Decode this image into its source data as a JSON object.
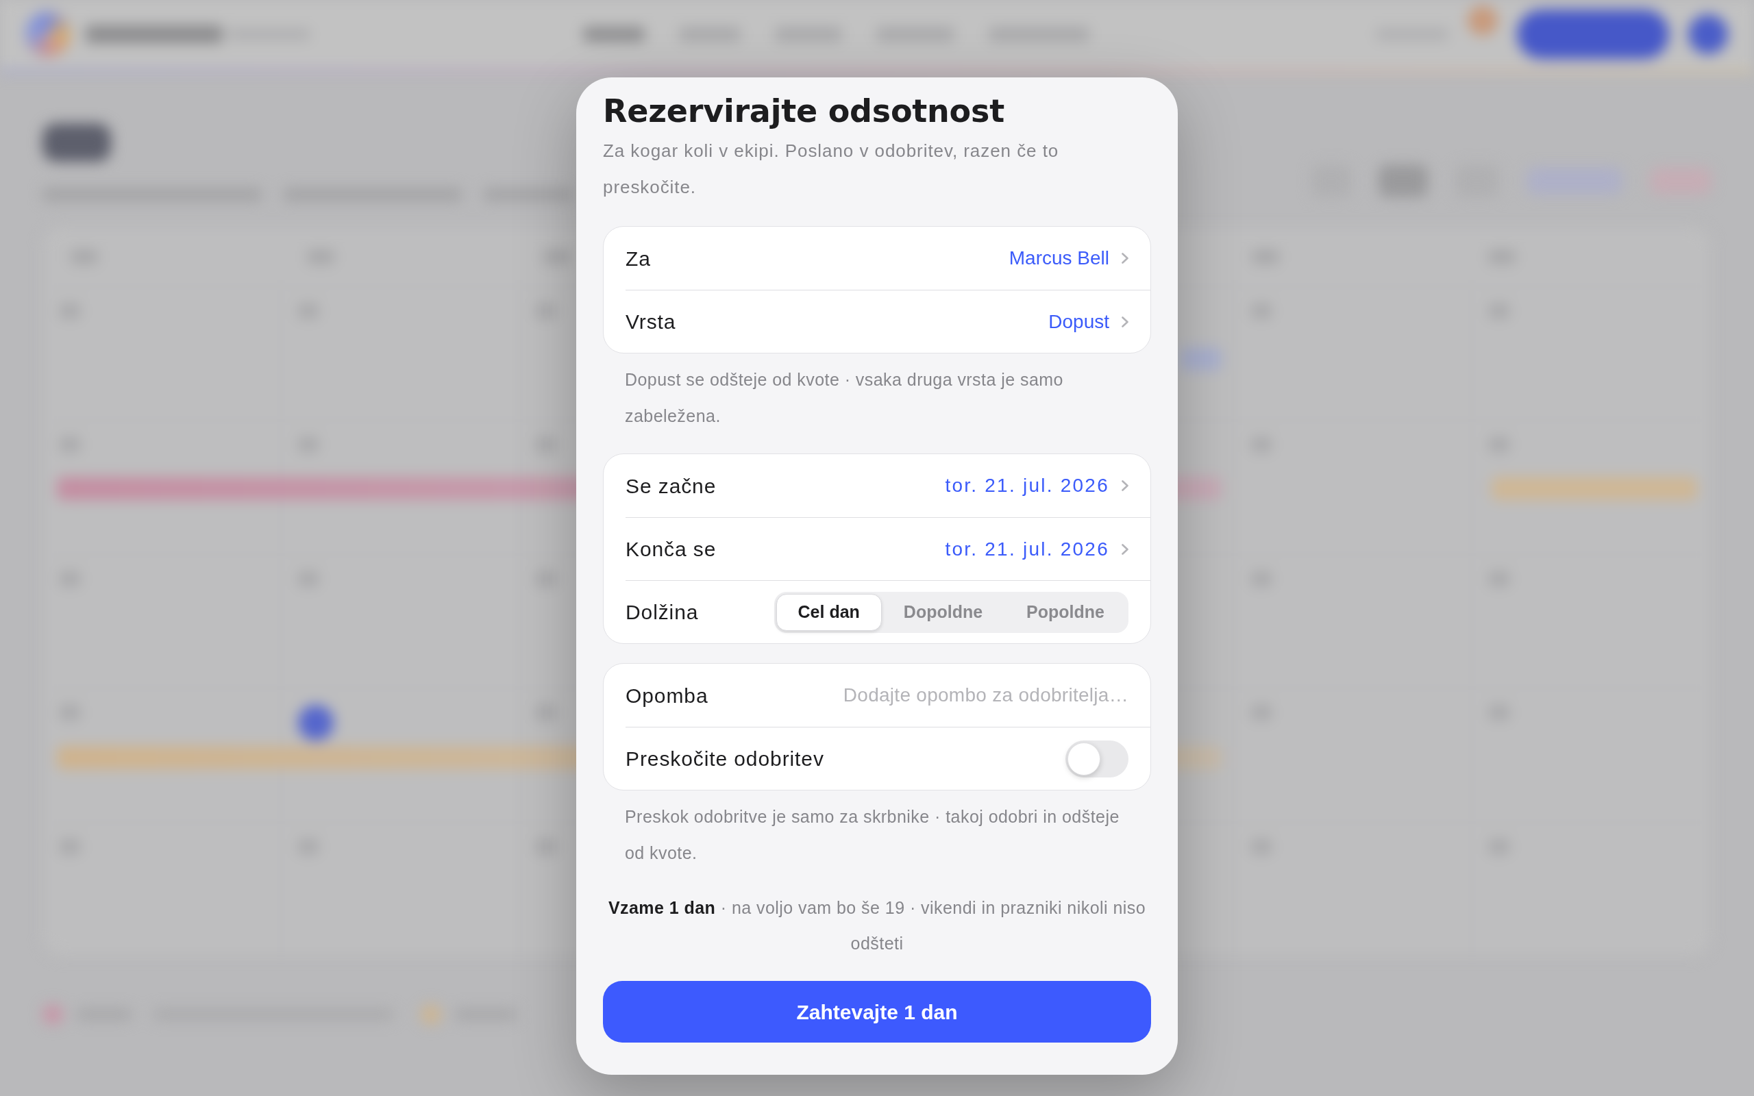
{
  "dialog": {
    "title": "Rezervirajte odsotnost",
    "subtitle": "Za kogar koli v ekipi. Poslano v odobritev, razen če to preskočite.",
    "sections": [
      {
        "rows": [
          {
            "kind": "picker",
            "label": "Za",
            "value": "Marcus Bell"
          },
          {
            "kind": "picker",
            "label": "Vrsta",
            "value": "Dopust"
          }
        ],
        "footnote": "Dopust se odšteje od kvote · vsaka druga vrsta je samo zabeležena."
      },
      {
        "rows": [
          {
            "kind": "date",
            "label": "Se začne",
            "value": "tor. 21. jul. 2026"
          },
          {
            "kind": "date",
            "label": "Konča se",
            "value": "tor. 21. jul. 2026"
          },
          {
            "kind": "segmented",
            "label": "Dolžina",
            "options": [
              {
                "label": "Cel dan",
                "selected": true
              },
              {
                "label": "Dopoldne",
                "selected": false
              },
              {
                "label": "Popoldne",
                "selected": false
              }
            ]
          }
        ]
      },
      {
        "rows": [
          {
            "kind": "text",
            "label": "Opomba",
            "placeholder": "Dodajte opombo za odobritelja…"
          },
          {
            "kind": "toggle",
            "label": "Preskočite odobritev",
            "on": false
          }
        ],
        "footnote": "Preskok odobritve je samo za skrbnike · takoj odobri in odšteje od kvote."
      }
    ],
    "summary": "**Vzame 1 dan** · na voljo vam bo še 19 · vikendi in prazniki nikoli niso odšteti",
    "submit_button": "Zahtevajte 1 dan"
  }
}
